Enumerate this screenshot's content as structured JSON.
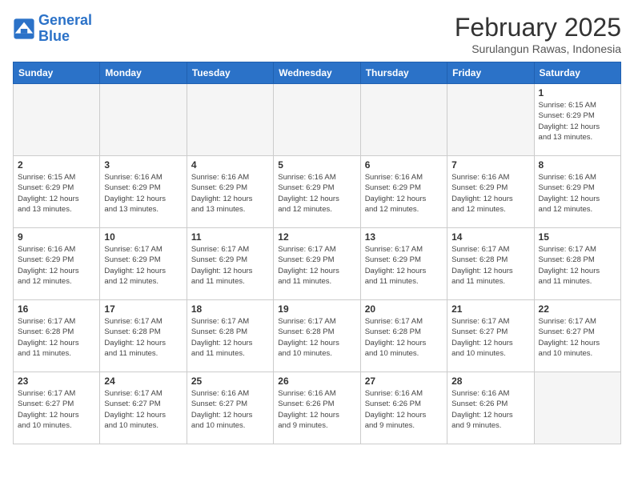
{
  "header": {
    "logo_line1": "General",
    "logo_line2": "Blue",
    "month": "February 2025",
    "location": "Surulangun Rawas, Indonesia"
  },
  "weekdays": [
    "Sunday",
    "Monday",
    "Tuesday",
    "Wednesday",
    "Thursday",
    "Friday",
    "Saturday"
  ],
  "weeks": [
    [
      {
        "day": "",
        "info": ""
      },
      {
        "day": "",
        "info": ""
      },
      {
        "day": "",
        "info": ""
      },
      {
        "day": "",
        "info": ""
      },
      {
        "day": "",
        "info": ""
      },
      {
        "day": "",
        "info": ""
      },
      {
        "day": "1",
        "info": "Sunrise: 6:15 AM\nSunset: 6:29 PM\nDaylight: 12 hours\nand 13 minutes."
      }
    ],
    [
      {
        "day": "2",
        "info": "Sunrise: 6:15 AM\nSunset: 6:29 PM\nDaylight: 12 hours\nand 13 minutes."
      },
      {
        "day": "3",
        "info": "Sunrise: 6:16 AM\nSunset: 6:29 PM\nDaylight: 12 hours\nand 13 minutes."
      },
      {
        "day": "4",
        "info": "Sunrise: 6:16 AM\nSunset: 6:29 PM\nDaylight: 12 hours\nand 13 minutes."
      },
      {
        "day": "5",
        "info": "Sunrise: 6:16 AM\nSunset: 6:29 PM\nDaylight: 12 hours\nand 12 minutes."
      },
      {
        "day": "6",
        "info": "Sunrise: 6:16 AM\nSunset: 6:29 PM\nDaylight: 12 hours\nand 12 minutes."
      },
      {
        "day": "7",
        "info": "Sunrise: 6:16 AM\nSunset: 6:29 PM\nDaylight: 12 hours\nand 12 minutes."
      },
      {
        "day": "8",
        "info": "Sunrise: 6:16 AM\nSunset: 6:29 PM\nDaylight: 12 hours\nand 12 minutes."
      }
    ],
    [
      {
        "day": "9",
        "info": "Sunrise: 6:16 AM\nSunset: 6:29 PM\nDaylight: 12 hours\nand 12 minutes."
      },
      {
        "day": "10",
        "info": "Sunrise: 6:17 AM\nSunset: 6:29 PM\nDaylight: 12 hours\nand 12 minutes."
      },
      {
        "day": "11",
        "info": "Sunrise: 6:17 AM\nSunset: 6:29 PM\nDaylight: 12 hours\nand 11 minutes."
      },
      {
        "day": "12",
        "info": "Sunrise: 6:17 AM\nSunset: 6:29 PM\nDaylight: 12 hours\nand 11 minutes."
      },
      {
        "day": "13",
        "info": "Sunrise: 6:17 AM\nSunset: 6:29 PM\nDaylight: 12 hours\nand 11 minutes."
      },
      {
        "day": "14",
        "info": "Sunrise: 6:17 AM\nSunset: 6:28 PM\nDaylight: 12 hours\nand 11 minutes."
      },
      {
        "day": "15",
        "info": "Sunrise: 6:17 AM\nSunset: 6:28 PM\nDaylight: 12 hours\nand 11 minutes."
      }
    ],
    [
      {
        "day": "16",
        "info": "Sunrise: 6:17 AM\nSunset: 6:28 PM\nDaylight: 12 hours\nand 11 minutes."
      },
      {
        "day": "17",
        "info": "Sunrise: 6:17 AM\nSunset: 6:28 PM\nDaylight: 12 hours\nand 11 minutes."
      },
      {
        "day": "18",
        "info": "Sunrise: 6:17 AM\nSunset: 6:28 PM\nDaylight: 12 hours\nand 11 minutes."
      },
      {
        "day": "19",
        "info": "Sunrise: 6:17 AM\nSunset: 6:28 PM\nDaylight: 12 hours\nand 10 minutes."
      },
      {
        "day": "20",
        "info": "Sunrise: 6:17 AM\nSunset: 6:28 PM\nDaylight: 12 hours\nand 10 minutes."
      },
      {
        "day": "21",
        "info": "Sunrise: 6:17 AM\nSunset: 6:27 PM\nDaylight: 12 hours\nand 10 minutes."
      },
      {
        "day": "22",
        "info": "Sunrise: 6:17 AM\nSunset: 6:27 PM\nDaylight: 12 hours\nand 10 minutes."
      }
    ],
    [
      {
        "day": "23",
        "info": "Sunrise: 6:17 AM\nSunset: 6:27 PM\nDaylight: 12 hours\nand 10 minutes."
      },
      {
        "day": "24",
        "info": "Sunrise: 6:17 AM\nSunset: 6:27 PM\nDaylight: 12 hours\nand 10 minutes."
      },
      {
        "day": "25",
        "info": "Sunrise: 6:16 AM\nSunset: 6:27 PM\nDaylight: 12 hours\nand 10 minutes."
      },
      {
        "day": "26",
        "info": "Sunrise: 6:16 AM\nSunset: 6:26 PM\nDaylight: 12 hours\nand 9 minutes."
      },
      {
        "day": "27",
        "info": "Sunrise: 6:16 AM\nSunset: 6:26 PM\nDaylight: 12 hours\nand 9 minutes."
      },
      {
        "day": "28",
        "info": "Sunrise: 6:16 AM\nSunset: 6:26 PM\nDaylight: 12 hours\nand 9 minutes."
      },
      {
        "day": "",
        "info": ""
      }
    ]
  ]
}
